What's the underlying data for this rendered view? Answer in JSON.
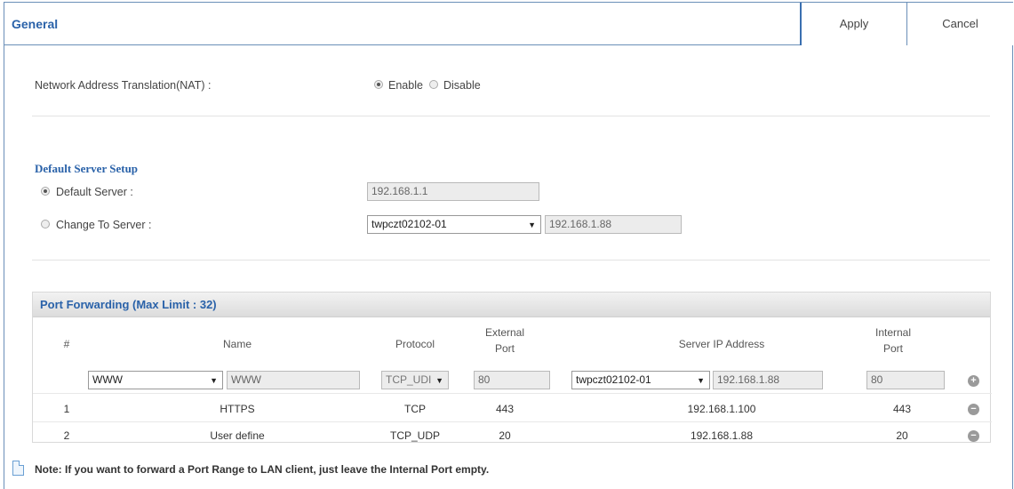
{
  "header": {
    "title": "General",
    "apply_label": "Apply",
    "cancel_label": "Cancel"
  },
  "nat": {
    "label": "Network Address Translation(NAT) :",
    "enable_label": "Enable",
    "disable_label": "Disable",
    "selected": "Enable"
  },
  "default_server": {
    "section_title": "Default Server Setup",
    "default_label": "Default Server :",
    "default_value": "192.168.1.1",
    "change_label": "Change To Server :",
    "change_select": "twpczt02102-01",
    "change_ip": "192.168.1.88",
    "selected": "Default Server"
  },
  "port_forwarding": {
    "title": "Port Forwarding (Max Limit : 32)",
    "headers": {
      "num": "#",
      "name": "Name",
      "protocol": "Protocol",
      "external_port_1": "External",
      "external_port_2": "Port",
      "server_ip": "Server IP Address",
      "internal_port_1": "Internal",
      "internal_port_2": "Port"
    },
    "input_row": {
      "name_select": "WWW",
      "name_input": "WWW",
      "protocol_select": "TCP_UDI",
      "external_port": "80",
      "server_select": "twpczt02102-01",
      "server_ip": "192.168.1.88",
      "internal_port": "80",
      "add_symbol": "+"
    },
    "rows": [
      {
        "num": "1",
        "name": "HTTPS",
        "protocol": "TCP",
        "external_port": "443",
        "server_ip": "192.168.1.100",
        "internal_port": "443",
        "remove_symbol": "−"
      },
      {
        "num": "2",
        "name": "User define",
        "protocol": "TCP_UDP",
        "external_port": "20",
        "server_ip": "192.168.1.88",
        "internal_port": "20",
        "remove_symbol": "−"
      }
    ]
  },
  "note": "Note: If you want to forward a Port Range to LAN client, just leave the Internal Port empty."
}
